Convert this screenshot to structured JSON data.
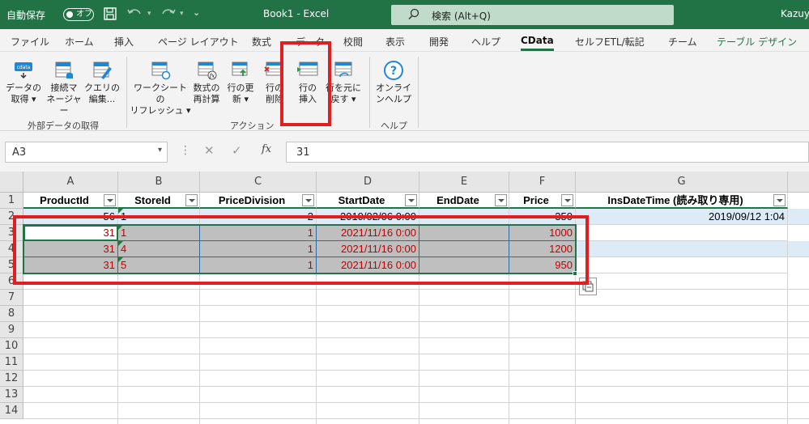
{
  "titlebar": {
    "autosave_label": "自動保存",
    "autosave_state": "オフ",
    "filename": "Book1  -  Excel",
    "search_placeholder": "検索 (Alt+Q)",
    "user": "Kazuy"
  },
  "menu": [
    "ファイル",
    "ホーム",
    "挿入",
    "ページ レイアウト",
    "数式",
    "データ",
    "校閲",
    "表示",
    "開発",
    "ヘルプ",
    "CData",
    "セルフETL/転記",
    "チーム",
    "テーブル デザイン"
  ],
  "ribbon": {
    "buttons": [
      {
        "l1": "データの",
        "l2": "取得 ▾"
      },
      {
        "l1": "接続マ",
        "l2": "ネージャー"
      },
      {
        "l1": "クエリの",
        "l2": "編集..."
      },
      {
        "l1": "ワークシートの",
        "l2": "リフレッシュ ▾"
      },
      {
        "l1": "数式の",
        "l2": "再計算"
      },
      {
        "l1": "行の更",
        "l2": "新 ▾"
      },
      {
        "l1": "行の",
        "l2": "削除"
      },
      {
        "l1": "行の",
        "l2": "挿入"
      },
      {
        "l1": "行を元に",
        "l2": "戻す ▾"
      },
      {
        "l1": "オンライ",
        "l2": "ンヘルプ"
      }
    ],
    "groups": [
      "外部データの取得",
      "アクション",
      "ヘルプ"
    ]
  },
  "formula": {
    "namebox": "A3",
    "fx": "fx",
    "value": "31"
  },
  "columns": [
    "A",
    "B",
    "C",
    "D",
    "E",
    "F",
    "G"
  ],
  "rows": [
    "1",
    "2",
    "3",
    "4",
    "5",
    "6",
    "7",
    "8",
    "9",
    "10",
    "11",
    "12",
    "13",
    "14"
  ],
  "table": {
    "headers": [
      "ProductId",
      "StoreId",
      "PriceDivision",
      "StartDate",
      "EndDate",
      "Price",
      "InsDateTime (読み取り専用)"
    ],
    "data": [
      [
        "56",
        "1",
        "2",
        "2019/02/06 0:00",
        "",
        "350",
        "2019/09/12 1:04"
      ],
      [
        "31",
        "1",
        "1",
        "2021/11/16 0:00",
        "",
        "1000",
        ""
      ],
      [
        "31",
        "4",
        "1",
        "2021/11/16 0:00",
        "",
        "1200",
        ""
      ],
      [
        "31",
        "5",
        "1",
        "2021/11/16 0:00",
        "",
        "950",
        ""
      ]
    ]
  }
}
